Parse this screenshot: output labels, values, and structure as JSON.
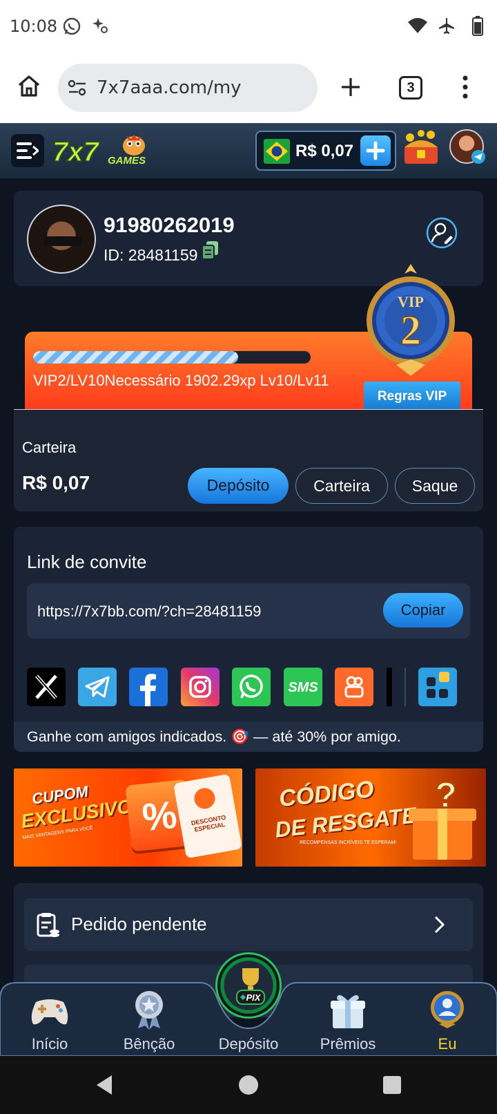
{
  "status_bar": {
    "time": "10:08"
  },
  "browser": {
    "url": "7x7aaa.com/my",
    "tab_count": "3"
  },
  "header": {
    "logo": "7x7 GAMES",
    "balance": "R$ 0,07"
  },
  "profile": {
    "username": "91980262019",
    "id_label": "ID: 28481159"
  },
  "vip": {
    "progress": 0.74,
    "text": "VIP2/LV10Necessário 1902.29xp Lv10/Lv11",
    "rules_label": "Regras VIP",
    "badge_label": "VIP",
    "badge_level": "2"
  },
  "wallet": {
    "label": "Carteira",
    "amount": "R$ 0,07",
    "deposit_label": "Depósito",
    "wallet_label": "Carteira",
    "withdraw_label": "Saque"
  },
  "invite": {
    "title": "Link de convite",
    "link": "https://7x7bb.com/?ch=28481159",
    "copy_label": "Copiar",
    "share_icons": [
      "x-icon",
      "telegram-icon",
      "facebook-icon",
      "instagram-icon",
      "whatsapp-icon",
      "sms-icon",
      "kwai-icon",
      "more-apps-icon"
    ],
    "sms_text": "SMS",
    "note": "Ganhe com amigos indicados. 🎯 — até 30% por amigo."
  },
  "promos": {
    "coupon_title_1": "CUPOM",
    "coupon_title_2": "EXCLUSIVO",
    "coupon_sub": "MAIS VANTAGENS PARA VOCÊ",
    "coupon_ticket": "DESCONTO ESPECIAL",
    "code_title_1": "CÓDIGO",
    "code_title_2": "DE RESGATE",
    "code_sub": "RECOMPENSAS INCRÍVEIS TE ESPERAM!"
  },
  "menu": {
    "pending_label": "Pedido pendente"
  },
  "nav": {
    "items": [
      "Início",
      "Bênção",
      "Depósito",
      "Prêmios",
      "Eu"
    ],
    "active": "Eu",
    "pix_label": "PIX"
  },
  "colors": {
    "accent": "#1e88e5",
    "vip_orange": "#ff5a24",
    "active_nav": "#f5d327",
    "bg": "#0e1420"
  }
}
